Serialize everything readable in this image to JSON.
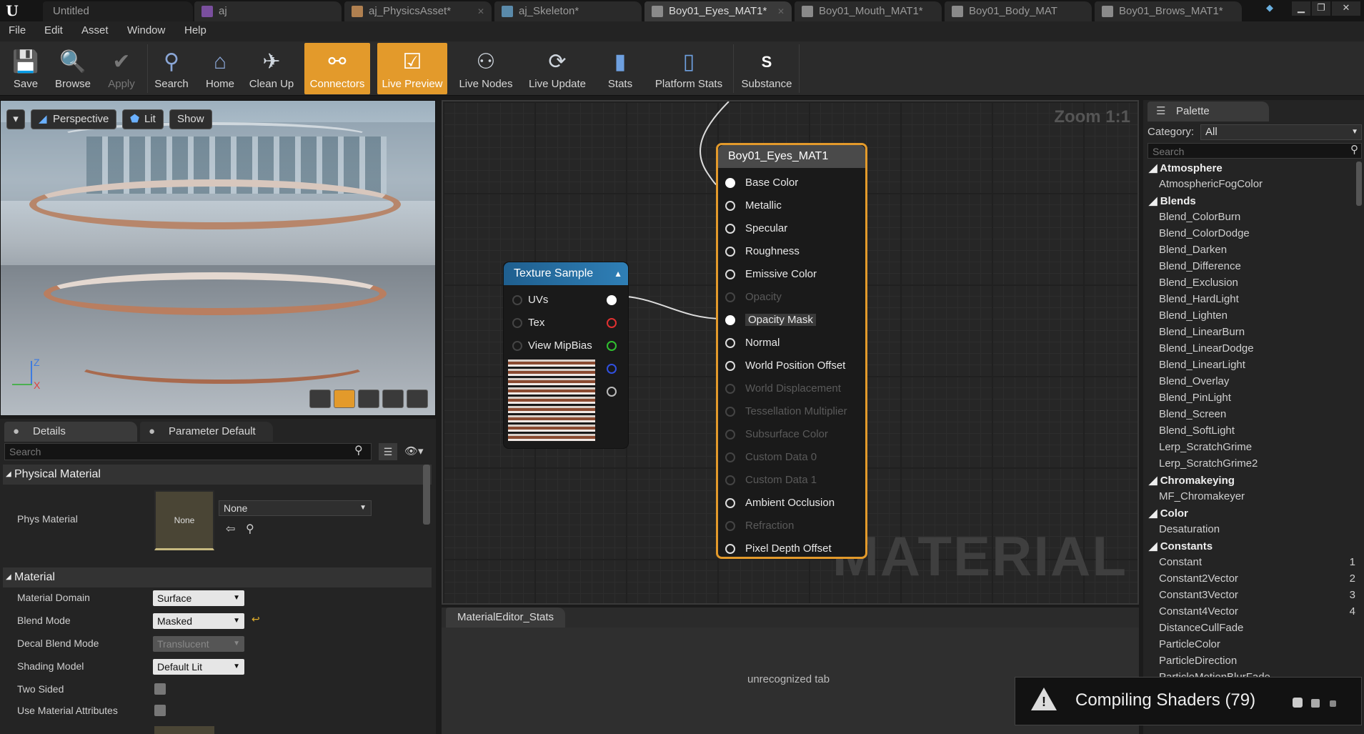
{
  "tabs": [
    {
      "label": "Untitled"
    },
    {
      "label": "aj"
    },
    {
      "label": "aj_PhysicsAsset*"
    },
    {
      "label": "aj_Skeleton*"
    },
    {
      "label": "Boy01_Eyes_MAT1*"
    },
    {
      "label": "Boy01_Mouth_MAT1*"
    },
    {
      "label": "Boy01_Body_MAT"
    },
    {
      "label": "Boy01_Brows_MAT1*"
    }
  ],
  "menu": [
    "File",
    "Edit",
    "Asset",
    "Window",
    "Help"
  ],
  "toolbar": [
    {
      "label": "Save",
      "icon": "save-icon"
    },
    {
      "label": "Browse",
      "icon": "browse-icon"
    },
    {
      "label": "Apply",
      "icon": "apply-icon"
    },
    {
      "label": "Search",
      "icon": "search-icon"
    },
    {
      "label": "Home",
      "icon": "home-icon"
    },
    {
      "label": "Clean Up",
      "icon": "clean-up-icon"
    },
    {
      "label": "Connectors",
      "icon": "connectors-icon"
    },
    {
      "label": "Live Preview",
      "icon": "live-preview-icon"
    },
    {
      "label": "Live Nodes",
      "icon": "live-nodes-icon"
    },
    {
      "label": "Live Update",
      "icon": "live-update-icon"
    },
    {
      "label": "Stats",
      "icon": "stats-icon"
    },
    {
      "label": "Platform Stats",
      "icon": "platform-stats-icon"
    },
    {
      "label": "Substance",
      "icon": "substance-icon"
    }
  ],
  "viewport": {
    "perspective": "Perspective",
    "lit": "Lit",
    "show": "Show",
    "axis_z": "Z",
    "axis_x": "X"
  },
  "details": {
    "tab_details": "Details",
    "tab_param": "Parameter Default",
    "search_placeholder": "Search",
    "physical_section": "Physical Material",
    "phys_label": "Phys Material",
    "phys_thumb": "None",
    "phys_value": "None",
    "material_section": "Material",
    "rows": [
      {
        "label": "Material Domain",
        "value": "Surface"
      },
      {
        "label": "Blend Mode",
        "value": "Masked"
      },
      {
        "label": "Decal Blend Mode",
        "value": "Translucent"
      },
      {
        "label": "Shading Model",
        "value": "Default Lit"
      },
      {
        "label": "Two Sided",
        "value": ""
      },
      {
        "label": "Use Material Attributes",
        "value": ""
      }
    ]
  },
  "graph": {
    "zoom": "Zoom 1:1",
    "watermark": "MATERIAL",
    "result_node": {
      "title": "Boy01_Eyes_MAT1",
      "pins": [
        "Base Color",
        "Metallic",
        "Specular",
        "Roughness",
        "Emissive Color",
        "Opacity",
        "Opacity Mask",
        "Normal",
        "World Position Offset",
        "World Displacement",
        "Tessellation Multiplier",
        "Subsurface Color",
        "Custom Data 0",
        "Custom Data 1",
        "Ambient Occlusion",
        "Refraction",
        "Pixel Depth Offset"
      ]
    },
    "texture_node": {
      "title": "Texture Sample",
      "pins": [
        "UVs",
        "Tex",
        "View MipBias"
      ]
    }
  },
  "stats": {
    "tab": "MaterialEditor_Stats",
    "message": "unrecognized tab"
  },
  "palette": {
    "tab": "Palette",
    "category_label": "Category:",
    "category_value": "All",
    "search_placeholder": "Search",
    "groups": [
      {
        "name": "Atmosphere",
        "items": [
          "AtmosphericFogColor"
        ]
      },
      {
        "name": "Blends",
        "items": [
          "Blend_ColorBurn",
          "Blend_ColorDodge",
          "Blend_Darken",
          "Blend_Difference",
          "Blend_Exclusion",
          "Blend_HardLight",
          "Blend_Lighten",
          "Blend_LinearBurn",
          "Blend_LinearDodge",
          "Blend_LinearLight",
          "Blend_Overlay",
          "Blend_PinLight",
          "Blend_Screen",
          "Blend_SoftLight",
          "Lerp_ScratchGrime",
          "Lerp_ScratchGrime2"
        ]
      },
      {
        "name": "Chromakeying",
        "items": [
          "MF_Chromakeyer"
        ]
      },
      {
        "name": "Color",
        "items": [
          "Desaturation"
        ]
      },
      {
        "name": "Constants",
        "items": [
          "Constant",
          "Constant2Vector",
          "Constant3Vector",
          "Constant4Vector",
          "DistanceCullFade",
          "ParticleColor",
          "ParticleDirection",
          "ParticleMotionBlurFade"
        ]
      }
    ],
    "shortcuts": [
      "1",
      "2",
      "3",
      "4"
    ]
  },
  "toast": {
    "message": "Compiling Shaders (79)"
  }
}
